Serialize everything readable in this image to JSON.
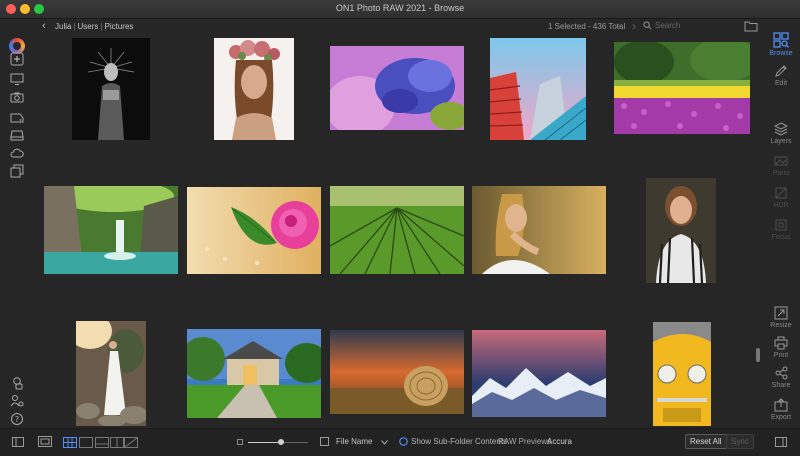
{
  "window": {
    "title": "ON1 Photo RAW 2021 - Browse"
  },
  "path": {
    "segments": [
      "Julia",
      "Users",
      "Pictures"
    ]
  },
  "toolbar": {
    "selection_info": "1 Selected - 436 Total",
    "search_placeholder": "Search"
  },
  "modules": [
    {
      "label": "Browse",
      "icon": "browse-icon",
      "state": "active"
    },
    {
      "label": "Edit",
      "icon": "edit-icon",
      "state": "normal"
    },
    {
      "label": "Layers",
      "icon": "layers-icon",
      "state": "normal"
    },
    {
      "label": "Pano",
      "icon": "pano-icon",
      "state": "disabled"
    },
    {
      "label": "HDR",
      "icon": "hdr-icon",
      "state": "disabled"
    },
    {
      "label": "Focus",
      "icon": "focus-icon",
      "state": "disabled"
    },
    {
      "label": "Resize",
      "icon": "resize-icon",
      "state": "normal"
    },
    {
      "label": "Print",
      "icon": "print-icon",
      "state": "normal"
    },
    {
      "label": "Share",
      "icon": "share-icon",
      "state": "normal"
    },
    {
      "label": "Export",
      "icon": "export-icon",
      "state": "normal"
    }
  ],
  "left_rail_icons": [
    "add-icon",
    "monitor-icon",
    "camera-icon",
    "drive-icon",
    "drive-stack-icon",
    "cloud-icon",
    "albums-icon",
    "filter-icon",
    "people-icon",
    "help-icon"
  ],
  "bottom": {
    "thumbnail_size": 0.55,
    "sort_label": "File Name",
    "subfolder_label": "Show Sub-Folder Contents",
    "raw_previews_label": "RAW Previews",
    "accurate_label": "Accura",
    "reset_all_label": "Reset All",
    "sync_label": "Sync"
  },
  "photos": [
    "portrait-crown-bw",
    "woman-flower-crown",
    "purple-hyacinth",
    "buildings-sky",
    "tulip-field",
    "waterfall",
    "pink-rose",
    "vineyard",
    "woman-golden-field",
    "woman-striped-shirt",
    "woman-white-dress-rocks",
    "house-garden",
    "hay-bale-sunset",
    "snowy-mountains",
    "yellow-beetle-car"
  ],
  "colors": {
    "accent": "#4f8ff7",
    "background": "#262626"
  }
}
